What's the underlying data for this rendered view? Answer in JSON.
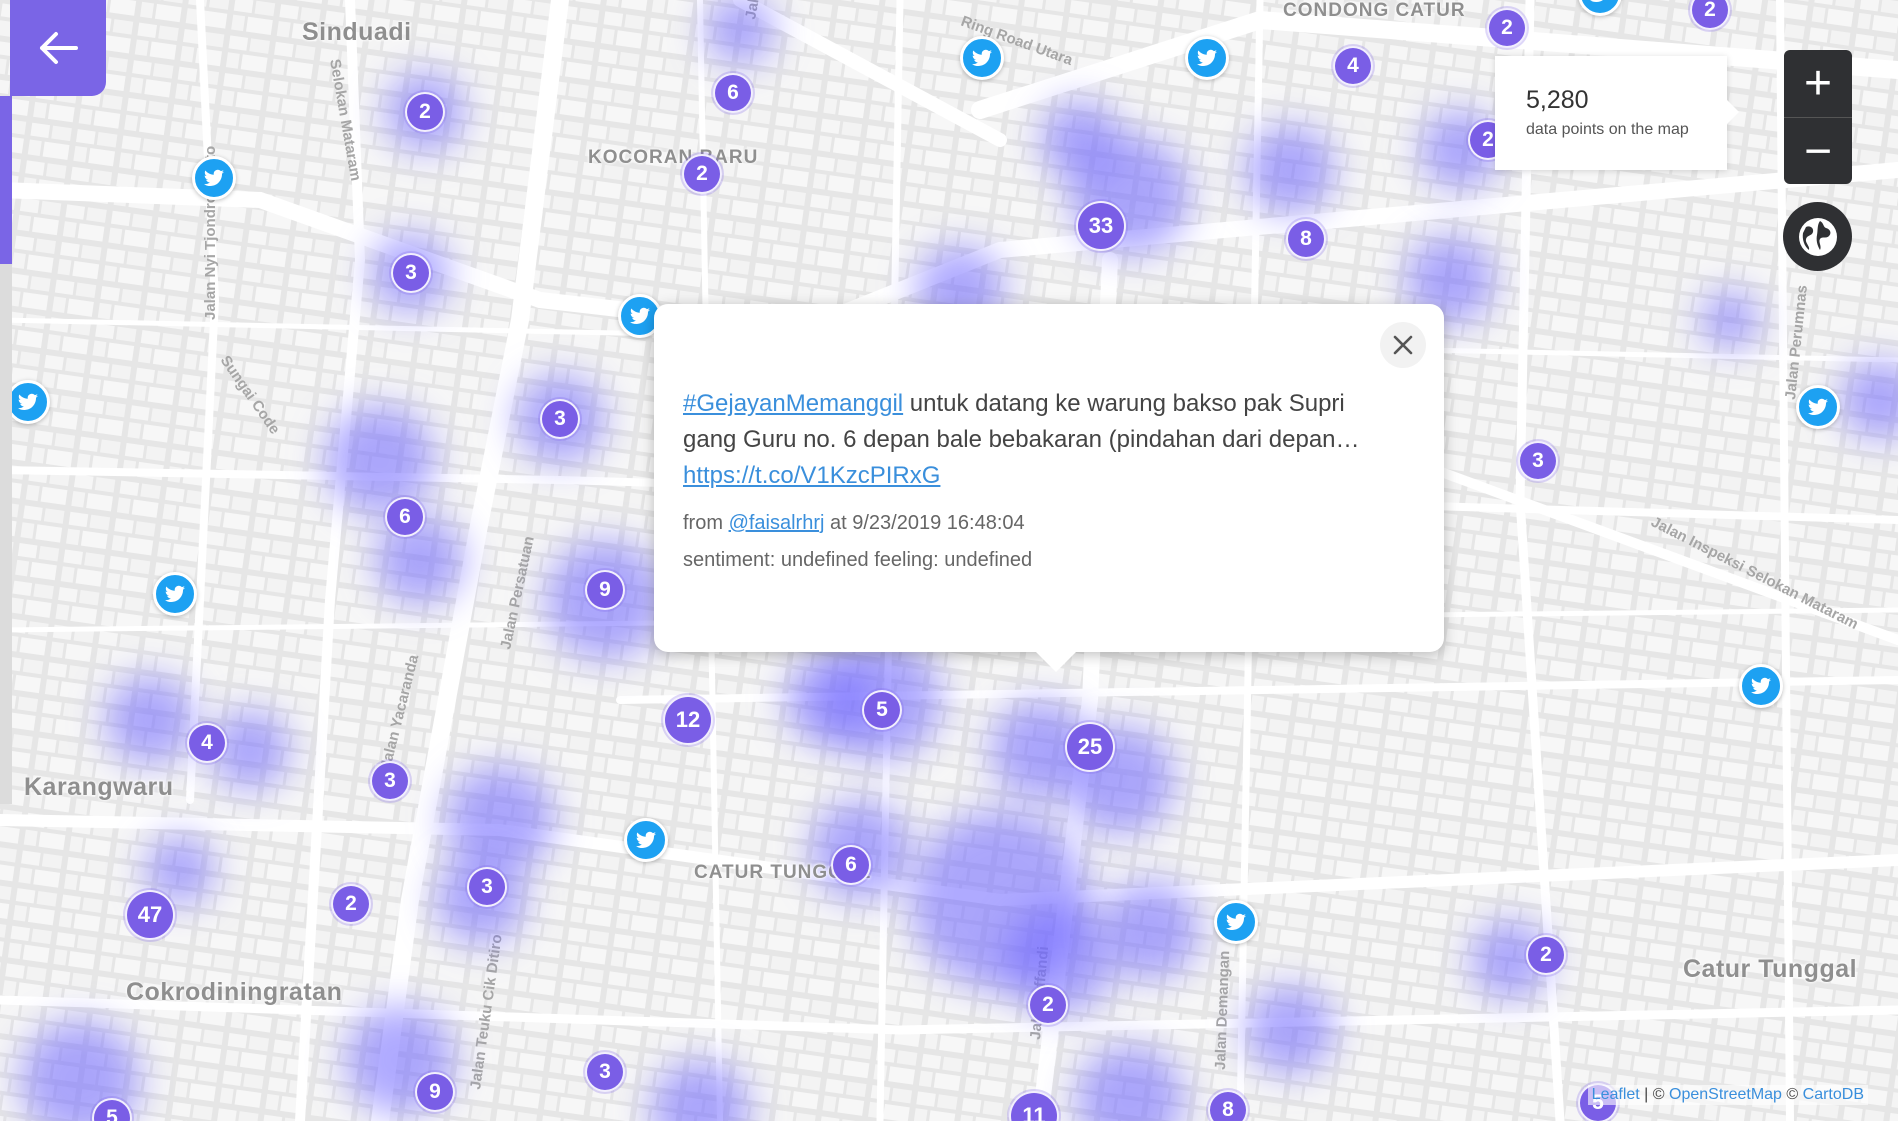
{
  "back_button": {
    "icon": "arrow-left-icon"
  },
  "counter": {
    "count": "5,280",
    "label": "data points on the map"
  },
  "zoom": {
    "in_label": "+",
    "out_label": "−"
  },
  "globe": {
    "icon": "globe-icon"
  },
  "popup": {
    "hashtag": "#GejayanMemanggil",
    "text": " untuk datang ke warung bakso pak Supri gang Guru no. 6 depan bale bebakaran (pindahan dari depan… ",
    "link": "https://t.co/V1KzcPIRxG",
    "from_prefix": "from ",
    "user": "@faisalrhrj",
    "at_text": " at 9/23/2019 16:48:04",
    "sentiment": "sentiment: undefined feeling: undefined",
    "close_icon": "close-icon"
  },
  "attribution": {
    "leaflet": "Leaflet",
    "sep1": " | © ",
    "osm": "OpenStreetMap",
    "sep2": " © ",
    "carto": "CartoDB"
  },
  "places": [
    {
      "name": "Sinduadi",
      "size": "lg"
    },
    {
      "name": "KOCORAN BARU",
      "size": "sm"
    },
    {
      "name": "CONDONG CATUR",
      "size": "sm"
    },
    {
      "name": "Karangwaru",
      "size": "lg"
    },
    {
      "name": "CATUR TUNGGAL",
      "size": "sm"
    },
    {
      "name": "Cokrodiningratan",
      "size": "lg"
    },
    {
      "name": "Catur Tunggal",
      "size": "lg"
    }
  ],
  "streets": [
    "Jalan Nyi Tjondroloekito",
    "Selokan Mataram",
    "Jalan Kaliurang",
    "Jalan Persatuan",
    "Jalan Yacaranda",
    "Jalan Teuku Cik Ditiro",
    "Jalan Affandi",
    "Jalan Demangan",
    "Jalan Inspeksi Selokan Mataram",
    "Ring Road Utara",
    "Sungai Code",
    "Jalan Perumnas"
  ],
  "clusters": [
    "2",
    "6",
    "2",
    "3",
    "4",
    "8",
    "33",
    "2",
    "3",
    "6",
    "9",
    "3",
    "5",
    "25",
    "4",
    "3",
    "12",
    "3",
    "2",
    "6",
    "47",
    "2",
    "3",
    "9",
    "5",
    "11",
    "8",
    "5",
    "2",
    "2",
    "2"
  ],
  "tweet_markers": 11
}
